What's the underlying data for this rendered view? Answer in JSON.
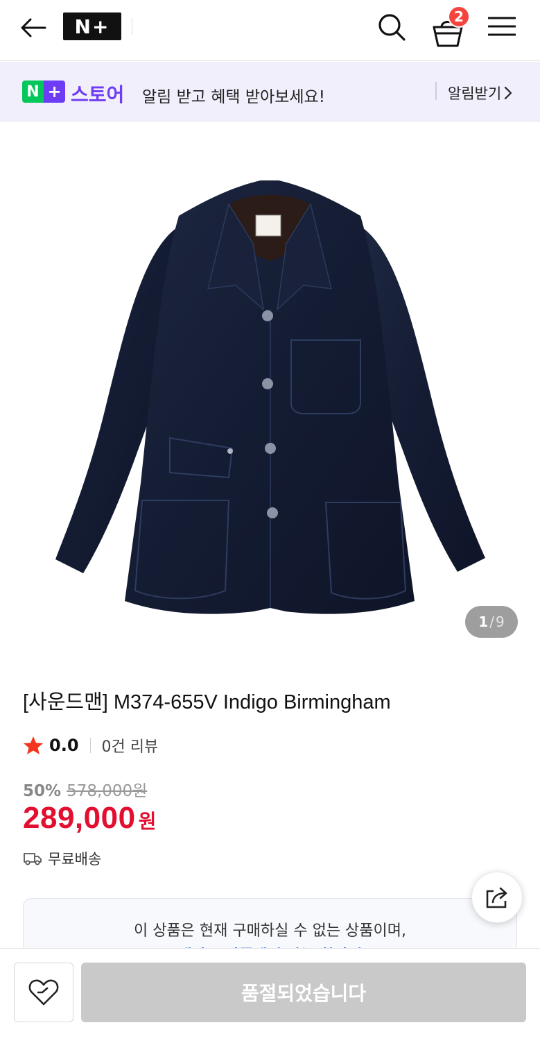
{
  "header": {
    "logo_text": "N+",
    "cart_count": "2",
    "icons": [
      "arrow-left-icon",
      "search-icon",
      "shopping-bag-icon",
      "hamburger-menu-icon"
    ]
  },
  "promo": {
    "logo_n": "N",
    "logo_plus": "+",
    "store_label": "스토어",
    "message": "알림 받고 혜택 받아보세요!",
    "action_label": "알림받기",
    "action_icon": "chevron-right-icon",
    "colors": {
      "n": "#03c75a",
      "plus": "#6e3cf5",
      "background": "#f1effb"
    }
  },
  "gallery": {
    "current": "1",
    "separator": "/",
    "total": "9"
  },
  "product": {
    "title": "[사운드맨] M374-655V Indigo Birmingham",
    "rating": "0.0",
    "review_count": "0건 리뷰",
    "discount_rate": "50%",
    "original_price": "578,000원",
    "sale_price": "289,000",
    "sale_unit": "원",
    "shipping": "무료배송",
    "price_color": "#e30f30"
  },
  "notice": {
    "line1": "이 상품은 현재 구매하실 수 없는 상품이며,",
    "line2": "대안고 상품에서 다는 찾아서"
  },
  "bottom": {
    "wish_icon": "heart-icon",
    "soldout_label": "품절되었습니다"
  }
}
